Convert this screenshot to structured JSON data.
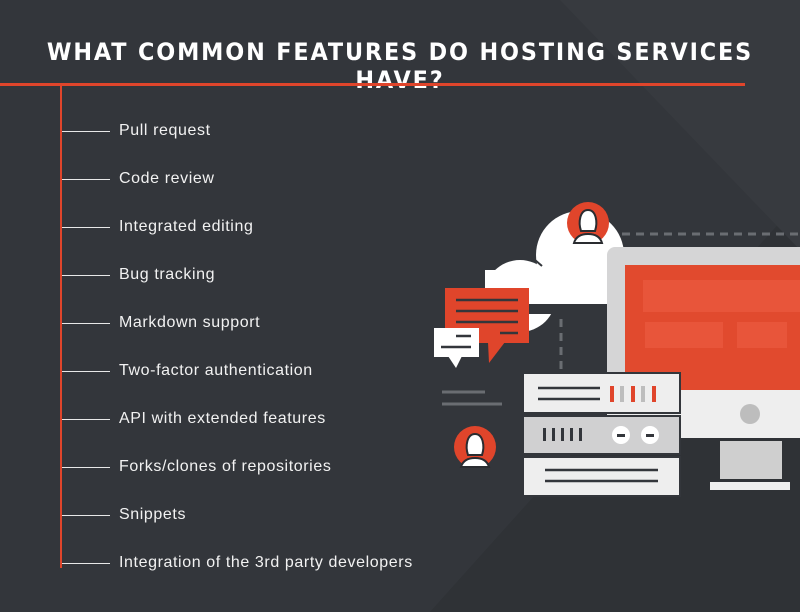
{
  "title": "WHAT COMMON FEATURES DO HOSTING SERVICES HAVE?",
  "features": [
    "Pull request",
    "Code review",
    "Integrated editing",
    "Bug tracking",
    "Markdown support",
    "Two-factor authentication",
    "API with extended features",
    "Forks/clones of repositories",
    "Snippets",
    "Integration of the 3rd party developers"
  ],
  "colors": {
    "background": "#33363b",
    "accent": "#e0452b",
    "text": "#ffffff"
  },
  "icons": [
    "cloud-icon",
    "user-avatar-icon",
    "speech-bubble-icon",
    "server-icon",
    "monitor-icon"
  ]
}
